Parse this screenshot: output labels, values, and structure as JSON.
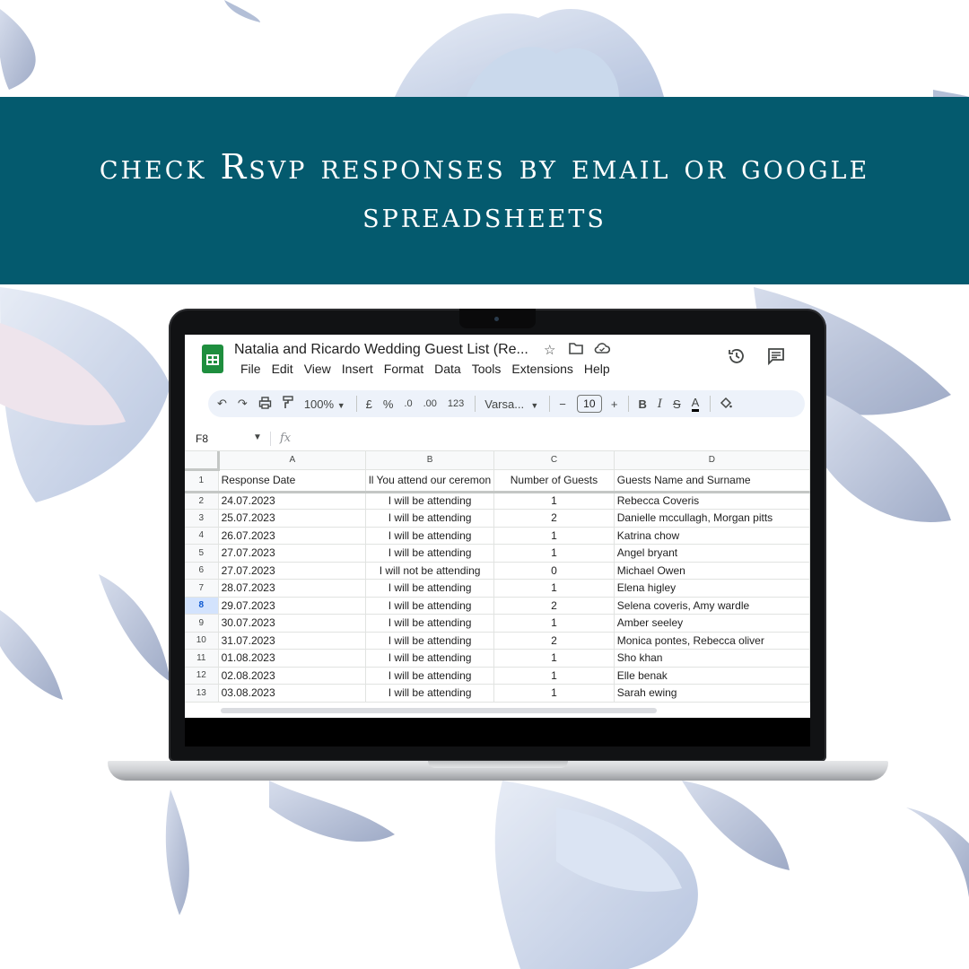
{
  "banner": {
    "line1": "check Rsvp responses by email or google",
    "line2": "spreadsheets"
  },
  "colors": {
    "banner_bg": "#045a6e",
    "banner_text": "#ffffff",
    "sheets_green": "#1e8e3e",
    "toolbar_bg": "#edf2fa"
  },
  "sheets": {
    "doc_title": "Natalia and Ricardo Wedding Guest List (Re...",
    "title_icons": [
      "star-icon",
      "move-to-folder-icon",
      "cloud-saved-icon"
    ],
    "menu": [
      "File",
      "Edit",
      "View",
      "Insert",
      "Format",
      "Data",
      "Tools",
      "Extensions",
      "Help"
    ],
    "top_right_icons": [
      "version-history-icon",
      "comments-icon"
    ],
    "toolbar": {
      "zoom": "100%",
      "currency": "£",
      "percent": "%",
      "decrease_decimal": ".0",
      "increase_decimal": ".00",
      "number_format": "123",
      "font": "Varsa...",
      "font_size": "10",
      "minus": "−",
      "plus": "+",
      "bold": "B",
      "italic": "I",
      "strike": "S",
      "text_color": "A"
    },
    "name_box": "F8",
    "fx": "fx",
    "columns": [
      "A",
      "B",
      "C",
      "D"
    ],
    "header_row": {
      "row_num": "1",
      "cells": [
        "Response Date",
        "ll You attend our ceremon",
        "Number of Guests",
        "Guests Name and Surname"
      ]
    },
    "active_row": "8",
    "rows": [
      {
        "num": "2",
        "date": "24.07.2023",
        "attend": "I will be attending",
        "guests": "1",
        "names": "Rebecca Coveris"
      },
      {
        "num": "3",
        "date": "25.07.2023",
        "attend": "I will be attending",
        "guests": "2",
        "names": "Danielle mccullagh, Morgan pitts"
      },
      {
        "num": "4",
        "date": "26.07.2023",
        "attend": "I will be attending",
        "guests": "1",
        "names": "Katrina chow"
      },
      {
        "num": "5",
        "date": "27.07.2023",
        "attend": "I will be attending",
        "guests": "1",
        "names": "Angel bryant"
      },
      {
        "num": "6",
        "date": "27.07.2023",
        "attend": "I will not be attending",
        "guests": "0",
        "names": "Michael Owen"
      },
      {
        "num": "7",
        "date": "28.07.2023",
        "attend": "I will be attending",
        "guests": "1",
        "names": "Elena higley"
      },
      {
        "num": "8",
        "date": "29.07.2023",
        "attend": "I will be attending",
        "guests": "2",
        "names": "Selena coveris, Amy wardle"
      },
      {
        "num": "9",
        "date": "30.07.2023",
        "attend": "I will be attending",
        "guests": "1",
        "names": "Amber seeley"
      },
      {
        "num": "10",
        "date": "31.07.2023",
        "attend": "I will be attending",
        "guests": "2",
        "names": "Monica pontes, Rebecca oliver"
      },
      {
        "num": "11",
        "date": "01.08.2023",
        "attend": "I will be attending",
        "guests": "1",
        "names": "Sho khan"
      },
      {
        "num": "12",
        "date": "02.08.2023",
        "attend": "I will be attending",
        "guests": "1",
        "names": "Elle benak"
      },
      {
        "num": "13",
        "date": "03.08.2023",
        "attend": "I will be attending",
        "guests": "1",
        "names": "Sarah ewing"
      }
    ]
  }
}
